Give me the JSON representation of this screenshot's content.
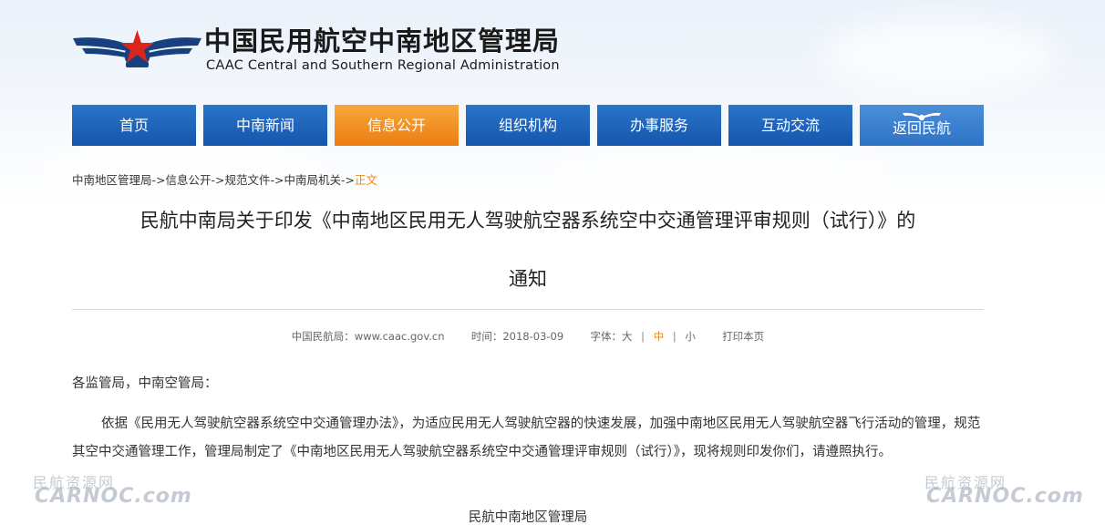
{
  "site": {
    "name_cn": "中国民用航空中南地区管理局",
    "name_en": "CAAC Central and Southern Regional Administration"
  },
  "nav": {
    "items": [
      {
        "label": "首页"
      },
      {
        "label": "中南新闻"
      },
      {
        "label": "信息公开"
      },
      {
        "label": "组织机构"
      },
      {
        "label": "办事服务"
      },
      {
        "label": "互动交流"
      },
      {
        "label": "返回民航"
      }
    ],
    "active_index": 2
  },
  "breadcrumb": {
    "items": [
      "中南地区管理局",
      "信息公开",
      "规范文件",
      "中南局机关"
    ],
    "separator": "->",
    "current": "正文"
  },
  "article": {
    "title_line1": "民航中南局关于印发《中南地区民用无人驾驶航空器系统空中交通管理评审规则（试行）》的",
    "title_line2": "通知",
    "meta": {
      "source": "中国民航局：www.caac.gov.cn",
      "time": "时间：2018-03-09",
      "font_label": "字体：",
      "font_large": "大",
      "font_medium": "中",
      "font_small": "小",
      "separator": "|",
      "print": "打印本页"
    },
    "salutation": "各监管局，中南空管局：",
    "body": "依据《民用无人驾驶航空器系统空中交通管理办法》，为适应民用无人驾驶航空器的快速发展，加强中南地区民用无人驾驶航空器飞行活动的管理，规范其空中交通管理工作，管理局制定了《中南地区民用无人驾驶航空器系统空中交通管理评审规则（试行）》，现将规则印发你们，请遵照执行。",
    "signature": "民航中南地区管理局"
  },
  "watermark": {
    "cn": "民航资源网",
    "en": "CARNOC.com"
  },
  "colors": {
    "nav_blue": "#1d63b8",
    "nav_active": "#f0891e",
    "accent_orange": "#e6891a"
  }
}
